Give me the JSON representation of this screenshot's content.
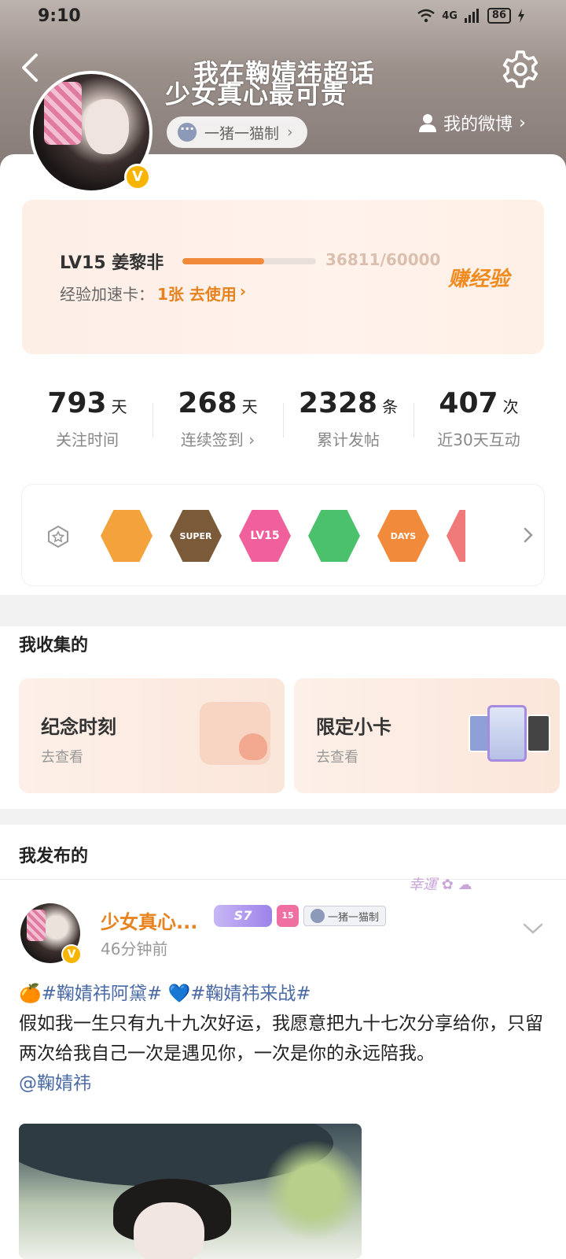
{
  "status_bar": {
    "time": "9:10",
    "signal_text": "4G",
    "battery": "86"
  },
  "header": {
    "title_line1": "我在鞠婧祎超话",
    "title_line2": "少女真心最可贵",
    "maker_chip": "一猪一猫制",
    "my_weibo": "我的微博"
  },
  "level": {
    "name": "LV15 姜黎非",
    "progress_text": "36811/60000",
    "progress_fraction": 0.613,
    "boost_label": "经验加速卡：",
    "boost_action": "1张 去使用",
    "earn_label": "赚经验"
  },
  "stats": [
    {
      "value": "793",
      "unit": "天",
      "label": "关注时间"
    },
    {
      "value": "268",
      "unit": "天",
      "label": "连续签到 ›"
    },
    {
      "value": "2328",
      "unit": "条",
      "label": "累计发帖"
    },
    {
      "value": "407",
      "unit": "次",
      "label": "近30天互动"
    }
  ],
  "badges": [
    {
      "icon": "crown-badge",
      "text": "",
      "color": "#f4a23b"
    },
    {
      "icon": "super-badge",
      "text": "SUPER",
      "color": "#7b5a3a"
    },
    {
      "icon": "lv15-badge",
      "text": "LV15",
      "color": "#f0609c"
    },
    {
      "icon": "hand-badge",
      "text": "",
      "color": "#4ac16a"
    },
    {
      "icon": "100-days-badge",
      "text": "DAYS",
      "color": "#f28a3c"
    }
  ],
  "collections": {
    "title": "我收集的",
    "items": [
      {
        "title": "纪念时刻",
        "action": "去查看"
      },
      {
        "title": "限定小卡",
        "action": "去查看"
      }
    ]
  },
  "posts": {
    "title": "我发布的",
    "item": {
      "author": "少女真心...",
      "time": "46分钟前",
      "badge_s7": "S7",
      "badge_gem": "15",
      "maker_tag": "一猪一猫制",
      "sticker_text": "幸運",
      "tags": "🍊#鞠婧祎阿黛# 💙#鞠婧祎来战#",
      "body": "假如我一生只有九十九次好运，我愿意把九十七次分享给你，只留两次给我自己一次是遇见你，一次是你的永远陪我。",
      "mention": "@鞠婧祎"
    }
  }
}
